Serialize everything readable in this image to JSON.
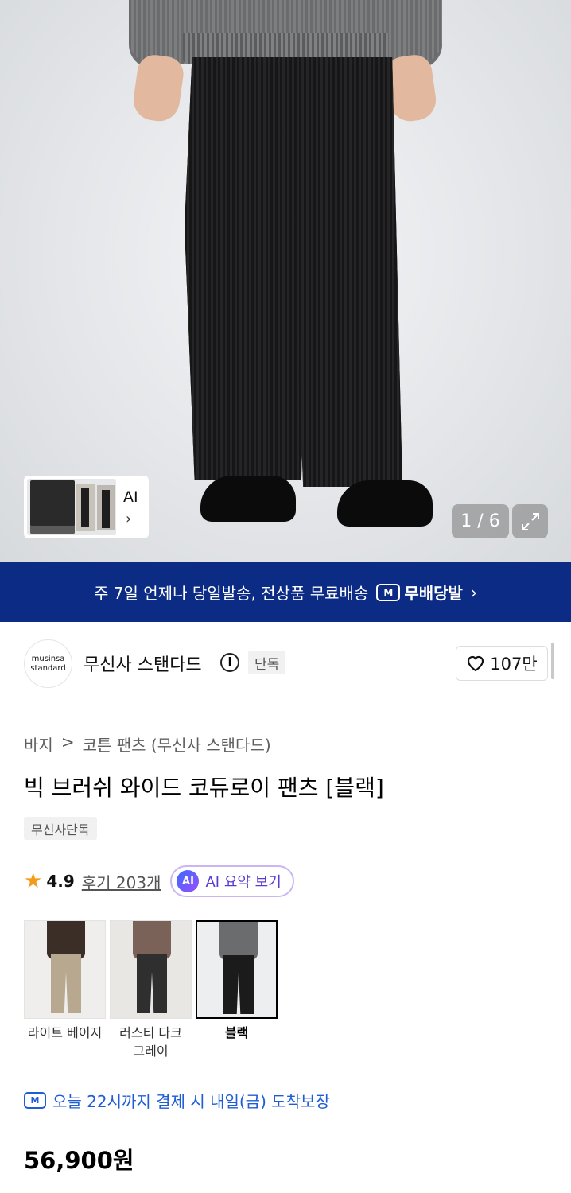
{
  "hero": {
    "counter": "1 / 6",
    "thumb_label": "AI",
    "thumb_chevron": "›",
    "expand_icon": "expand-icon"
  },
  "banner": {
    "text": "주 7일 언제나 당일발송, 전상품 무료배송",
    "brand": "무배당발",
    "truck_letter": "M",
    "chevron": "›"
  },
  "brand": {
    "logo_line1": "musinsa",
    "logo_line2": "standard",
    "name": "무신사 스탠다드",
    "info_glyph": "i",
    "badge": "단독",
    "likes": "107만"
  },
  "product": {
    "breadcrumb": [
      "바지",
      ">",
      "코튼 팬츠 (무신사 스탠다드)"
    ],
    "title": "빅 브러쉬 와이드 코듀로이 팬츠 [블랙]",
    "tag": "무신사단독",
    "rating": "4.9",
    "reviews": "후기 203개",
    "ai_badge": "AI",
    "ai_summary": "AI 요약 보기"
  },
  "variants": [
    {
      "label": "라이트 베이지",
      "top": "#3a2e27",
      "bottom": "#b9a890",
      "selected": false
    },
    {
      "label": "러스티 다크 그레이",
      "top": "#7a6259",
      "bottom": "#2f2f30",
      "selected": false
    },
    {
      "label": "블랙",
      "top": "#6b6c6e",
      "bottom": "#1b1b1c",
      "selected": true
    }
  ],
  "delivery": {
    "truck_letter": "M",
    "text": "오늘 22시까지 결제 시 내일(금) 도착보장"
  },
  "price": "56,900원",
  "colors": {
    "banner_bg": "#0b2b84",
    "delivery_blue": "#1f5dd6",
    "star": "#f39c1b",
    "ai_purple": "#5b3bd6"
  }
}
